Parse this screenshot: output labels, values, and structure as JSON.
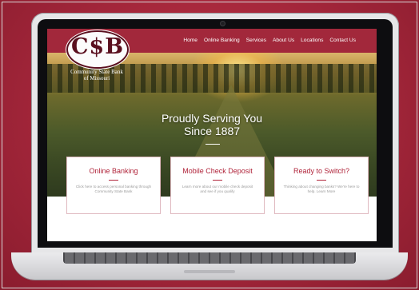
{
  "website": {
    "nav": {
      "items": [
        "Home",
        "Online Banking",
        "Services",
        "About Us",
        "Locations",
        "Contact Us"
      ]
    },
    "logo": {
      "letters": "C$B",
      "name_line1": "Community State Bank",
      "name_line2": "of Missouri"
    },
    "hero": {
      "title_line1": "Proudly Serving You",
      "title_line2": "Since 1887"
    },
    "cards": [
      {
        "title": "Online Banking",
        "text": "Click here to access personal banking through Community State Bank"
      },
      {
        "title": "Mobile Check Deposit",
        "text": "Learn more about our mobile check deposit and see if you qualify"
      },
      {
        "title": "Ready to Switch?",
        "text": "Thinking about changing banks? We're here to help. Learn More"
      }
    ]
  },
  "colors": {
    "brand": "#a2283b",
    "background": "#a8283a",
    "accent_text": "#b0243a"
  }
}
